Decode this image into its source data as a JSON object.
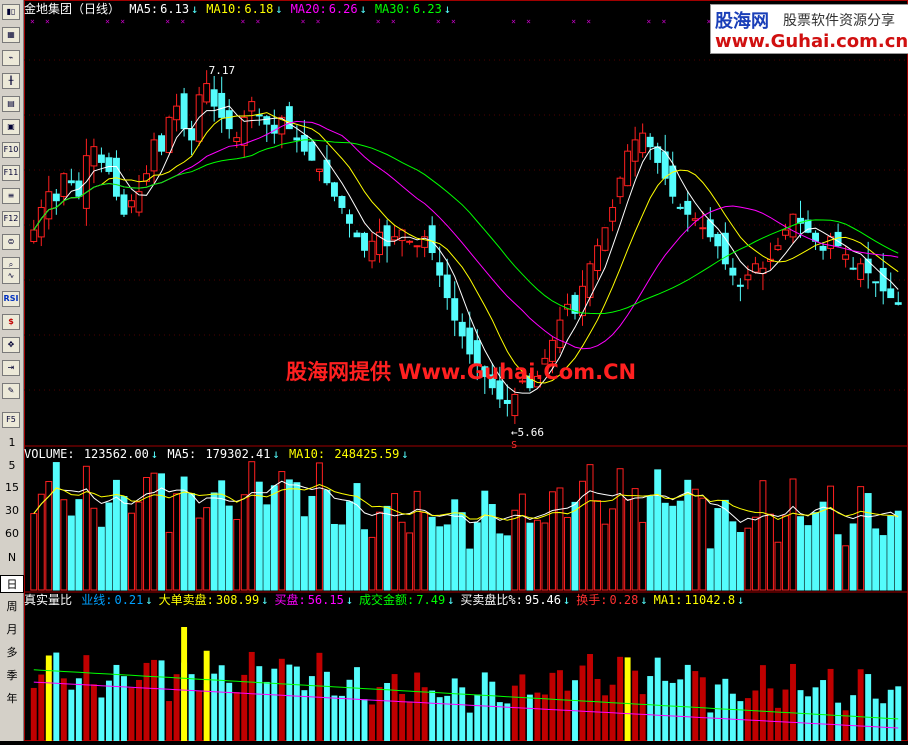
{
  "toolbar": {
    "icons": [
      "bar-chart",
      "table",
      "line-chart",
      "candle-chart",
      "book",
      "document",
      "F10",
      "F11",
      "list",
      "F12",
      "coins",
      "search",
      "pulse-chart",
      "RSI",
      "dollar",
      "move",
      "exit",
      "pencil",
      "F5"
    ],
    "period_buttons": [
      "1",
      "5",
      "15",
      "30",
      "60",
      "N",
      "日",
      "周",
      "月",
      "多",
      "季",
      "年"
    ],
    "labels": {
      "rsi": "RSI",
      "f5": "F5",
      "f10": "F10",
      "f11": "F11",
      "f12": "F12"
    }
  },
  "header": {
    "stock": "金地集团（日线）",
    "ma": [
      {
        "label": "MA5:",
        "value": "6.13",
        "arrow": "↓",
        "color": "#ffffff"
      },
      {
        "label": "MA10:",
        "value": "6.18",
        "arrow": "↓",
        "color": "#ffff00"
      },
      {
        "label": "MA20:",
        "value": "6.26",
        "arrow": "↓",
        "color": "#ff00ff"
      },
      {
        "label": "MA30:",
        "value": "6.23",
        "arrow": "↓",
        "color": "#00ff00"
      }
    ]
  },
  "logo": {
    "name": "股海网",
    "tagline": "股票软件资源分享",
    "url": "www.Guhai.com.cn"
  },
  "watermark": "股海网提供 Www.Guhai.Com.CN",
  "annotations": {
    "high": "7.17",
    "low": "←5.66",
    "low_marker": "S"
  },
  "volume_header": {
    "label": "VOLUME:",
    "value": "123562.00",
    "ma5_label": "MA5:",
    "ma5": "179302.41",
    "ma10_label": "MA10:",
    "ma10": "248425.59",
    "arrow": "↓"
  },
  "indicator_header": {
    "name": "真实量比",
    "items": [
      {
        "label": "业线:",
        "value": "0.21",
        "color": "#00a0ff"
      },
      {
        "label": "大单卖盘:",
        "value": "308.99",
        "color": "#ffff00"
      },
      {
        "label": "买盘:",
        "value": "56.15",
        "color": "#ff00ff"
      },
      {
        "label": "成交金额:",
        "value": "7.49",
        "color": "#00ff00"
      },
      {
        "label": "买卖盘比%:",
        "value": "95.46",
        "color": "#ffffff"
      },
      {
        "label": "换手:",
        "value": "0.28",
        "color": "#ff3030"
      },
      {
        "label": "MA1:",
        "value": "11042.8",
        "color": "#ffff00"
      }
    ]
  },
  "colors": {
    "up": "#ff2020",
    "down": "#54fcfc",
    "ma5": "#ffffff",
    "ma10": "#ffff00",
    "ma20": "#ff00ff",
    "ma30": "#00ff00",
    "frame": "#a00000",
    "yellow_bar": "#ffff00",
    "dark_red_bar": "#c00000"
  },
  "chart_data": {
    "type": "candlestick",
    "price_ylim": [
      5.5,
      7.4
    ],
    "closes": [
      6.45,
      6.55,
      6.62,
      6.58,
      6.7,
      6.66,
      6.6,
      6.78,
      6.82,
      6.75,
      6.71,
      6.6,
      6.52,
      6.58,
      6.62,
      6.7,
      6.85,
      6.8,
      6.95,
      7.0,
      6.9,
      6.85,
      7.05,
      7.1,
      7.0,
      6.95,
      6.9,
      6.86,
      6.95,
      7.02,
      6.96,
      6.92,
      6.88,
      6.95,
      6.9,
      6.85,
      6.8,
      6.76,
      6.72,
      6.66,
      6.6,
      6.55,
      6.48,
      6.42,
      6.36,
      6.4,
      6.44,
      6.38,
      6.42,
      6.45,
      6.4,
      6.38,
      6.42,
      6.35,
      6.25,
      6.15,
      6.05,
      5.98,
      5.9,
      5.85,
      5.8,
      5.75,
      5.7,
      5.68,
      5.72,
      5.78,
      5.75,
      5.8,
      5.88,
      5.96,
      6.05,
      6.12,
      6.08,
      6.2,
      6.3,
      6.38,
      6.46,
      6.55,
      6.68,
      6.8,
      6.85,
      6.88,
      6.82,
      6.75,
      6.68,
      6.6,
      6.55,
      6.52,
      6.5,
      6.46,
      6.42,
      6.38,
      6.3,
      6.25,
      6.2,
      6.25,
      6.3,
      6.28,
      6.32,
      6.38,
      6.45,
      6.52,
      6.48,
      6.44,
      6.4,
      6.36,
      6.42,
      6.38,
      6.34,
      6.28,
      6.3,
      6.26,
      6.22,
      6.18,
      6.15,
      6.12
    ]
  }
}
